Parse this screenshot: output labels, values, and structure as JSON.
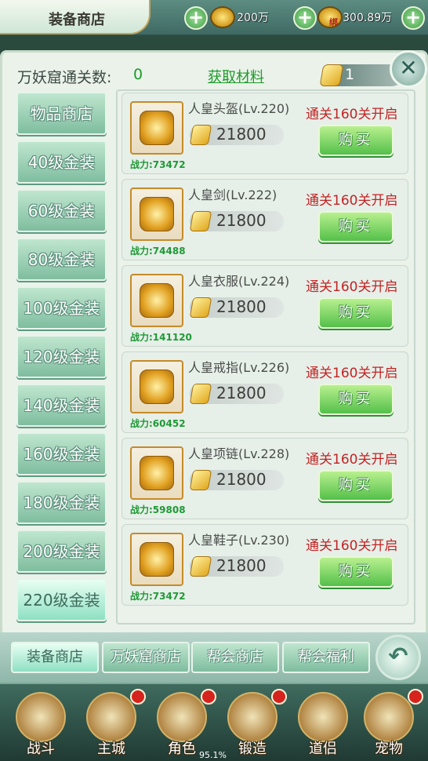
{
  "header": {
    "title": "装备商店",
    "gold_amount": "200万",
    "bound_gold_amount": "300.89万",
    "bound_tag": "绑"
  },
  "panel": {
    "clear_label": "万妖窟通关数:",
    "clear_value": "0",
    "get_materials": "获取材料",
    "token_count": "1",
    "close_symbol": "✕"
  },
  "categories": [
    {
      "label": "物品商店"
    },
    {
      "label": "40级金装"
    },
    {
      "label": "60级金装"
    },
    {
      "label": "80级金装"
    },
    {
      "label": "100级金装"
    },
    {
      "label": "120级金装"
    },
    {
      "label": "140级金装"
    },
    {
      "label": "160级金装"
    },
    {
      "label": "180级金装"
    },
    {
      "label": "200级金装"
    },
    {
      "label": "220级金装"
    }
  ],
  "items": [
    {
      "name": "人皇头盔(Lv.220)",
      "price": "21800",
      "power": "战力:73472",
      "unlock": "通关160关开启",
      "buy": "购买",
      "icon": "helmet-icon"
    },
    {
      "name": "人皇剑(Lv.222)",
      "price": "21800",
      "power": "战力:74488",
      "unlock": "通关160关开启",
      "buy": "购买",
      "icon": "sword-icon"
    },
    {
      "name": "人皇衣服(Lv.224)",
      "price": "21800",
      "power": "战力:141120",
      "unlock": "通关160关开启",
      "buy": "购买",
      "icon": "armor-icon"
    },
    {
      "name": "人皇戒指(Lv.226)",
      "price": "21800",
      "power": "战力:60452",
      "unlock": "通关160关开启",
      "buy": "购买",
      "icon": "ring-icon"
    },
    {
      "name": "人皇项链(Lv.228)",
      "price": "21800",
      "power": "战力:59808",
      "unlock": "通关160关开启",
      "buy": "购买",
      "icon": "necklace-icon"
    },
    {
      "name": "人皇鞋子(Lv.230)",
      "price": "21800",
      "power": "战力:73472",
      "unlock": "通关160关开启",
      "buy": "购买",
      "icon": "boots-icon"
    }
  ],
  "shop_tabs": [
    {
      "label": "装备商店"
    },
    {
      "label": "万妖窟商店"
    },
    {
      "label": "帮会商店"
    },
    {
      "label": "帮会福利"
    }
  ],
  "nav": [
    {
      "label": "战斗",
      "badge": false
    },
    {
      "label": "主城",
      "badge": true
    },
    {
      "label": "角色",
      "badge": true
    },
    {
      "label": "锻造",
      "badge": true
    },
    {
      "label": "道侣",
      "badge": false
    },
    {
      "label": "宠物",
      "badge": true
    }
  ],
  "loading_text": "95.1%",
  "colors": {
    "accent_green": "#1e9b2b",
    "unlock_red": "#c22424",
    "gold": "#e0a71c"
  }
}
